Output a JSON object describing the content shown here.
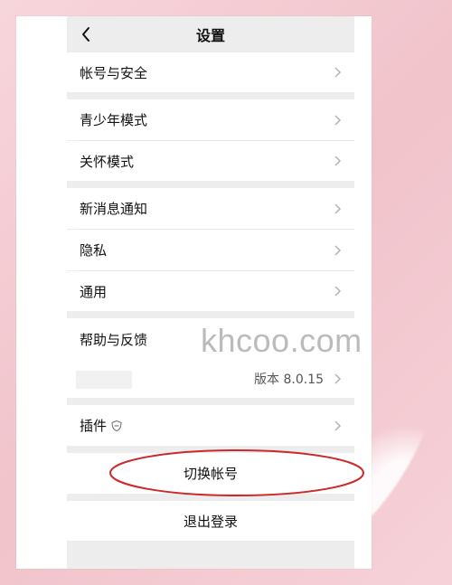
{
  "header": {
    "title": "设置"
  },
  "menu": {
    "account_security": "帐号与安全",
    "youth_mode": "青少年模式",
    "care_mode": "关怀模式",
    "new_message_notification": "新消息通知",
    "privacy": "隐私",
    "general": "通用",
    "help_feedback": "帮助与反馈",
    "version": "版本 8.0.15",
    "plugins": "插件",
    "switch_account": "切换帐号",
    "logout": "退出登录"
  },
  "watermark": "khcoo.com",
  "colors": {
    "annotation_ellipse": "#cc2a2a",
    "page_bg": "#ededed",
    "outer_bg": "#f3ccd2"
  },
  "icons": [
    "chevron-left-icon",
    "chevron-right-icon",
    "plugin-shield-icon"
  ]
}
